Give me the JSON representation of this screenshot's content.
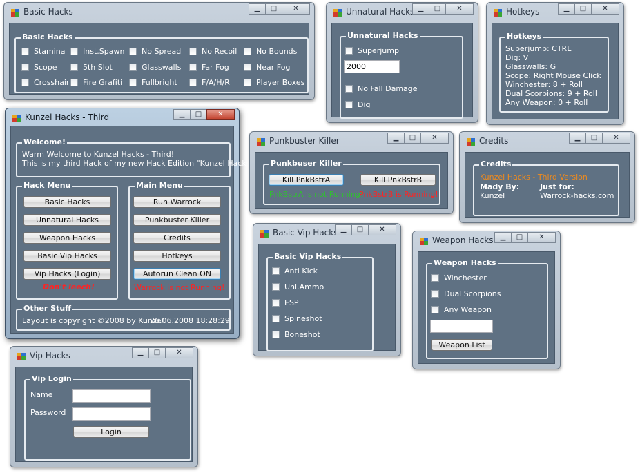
{
  "basic_hacks": {
    "title": "Basic Hacks",
    "group": "Basic Hacks",
    "checkboxes": [
      "Stamina",
      "Inst.Spawn",
      "No Spread",
      "No Recoil",
      "No Bounds",
      "Scope",
      "5th Slot",
      "Glasswalls",
      "Far Fog",
      "Near Fog",
      "Crosshair",
      "Fire Grafiti",
      "Fullbright",
      "F/A/H/R",
      "Player Boxes"
    ]
  },
  "unnatural_hacks": {
    "title": "Unnatural Hacks",
    "group": "Unnatural Hacks",
    "superjump": "Superjump",
    "jump_value": "2000",
    "no_fall_damage": "No Fall Damage",
    "dig": "Dig"
  },
  "hotkeys": {
    "title": "Hotkeys",
    "group": "Hotkeys",
    "lines": [
      "Superjump: CTRL",
      "Dig: V",
      "Glasswalls: G",
      "Scope: Right Mouse Click",
      "Winchester: 8 + Roll",
      "Dual Scorpions: 9 + Roll",
      "Any Weapon: 0 + Roll"
    ]
  },
  "main": {
    "title": "Kunzel Hacks - Third",
    "welcome_group": "Welcome!",
    "welcome_line1": "Warm Welcome to Kunzel Hacks - Third!",
    "welcome_line2": "This is my third Hack of my new Hack Edition \"Kunzel Hacks\"!",
    "hack_menu_group": "Hack Menu",
    "hack_menu_buttons": [
      "Basic Hacks",
      "Unnatural Hacks",
      "Weapon Hacks",
      "Basic Vip Hacks",
      "Vip Hacks (Login)"
    ],
    "dont_leech": "Don't leech!",
    "main_menu_group": "Main Menu",
    "main_menu_buttons": [
      "Run Warrock",
      "Punkbuster Killer",
      "Credits",
      "Hotkeys",
      "Autorun Clean ON"
    ],
    "warrock_status": "Warrock is not Running!",
    "other_group": "Other Stuff",
    "copyright": "Layout is copyright ©2008 by Kunzel",
    "datetime": "26.06.2008 18:28:29"
  },
  "punkbuster": {
    "title": "Punkbuster Killer",
    "group": "Punkbuser Killer",
    "btn_a": "Kill PnkBstrA",
    "btn_b": "Kill PnkBstrB",
    "status_a": "PnkBstrA is not Running!",
    "status_b": "PnkBstrB is Running!"
  },
  "credits": {
    "title": "Credits",
    "group": "Credits",
    "version": "Kunzel Hacks - Third Version",
    "made_by_label": "Mady By:",
    "just_for_label": "Just for:",
    "made_by": "Kunzel",
    "just_for": "Warrock-hacks.com"
  },
  "basic_vip": {
    "title": "Basic Vip Hacks",
    "group": "Basic Vip Hacks",
    "checkboxes": [
      "Anti Kick",
      "Unl.Ammo",
      "ESP",
      "Spineshot",
      "Boneshot"
    ]
  },
  "weapon_hacks": {
    "title": "Weapon Hacks",
    "group": "Weapon Hacks",
    "checkboxes": [
      "Winchester",
      "Dual Scorpions",
      "Any Weapon"
    ],
    "input_value": "",
    "button": "Weapon List"
  },
  "vip_hacks": {
    "title": "Vip Hacks",
    "group": "Vip Login",
    "name_label": "Name",
    "password_label": "Password",
    "name_value": "",
    "password_value": "",
    "login_button": "Login"
  },
  "window_controls": {
    "minimize": "▁",
    "maximize": "□",
    "close": "✕"
  },
  "colors": {
    "client_bg": "#5f7183",
    "ok_green": "#2fc22f",
    "error_red": "#ff2323",
    "accent_orange": "#f08b1d"
  }
}
